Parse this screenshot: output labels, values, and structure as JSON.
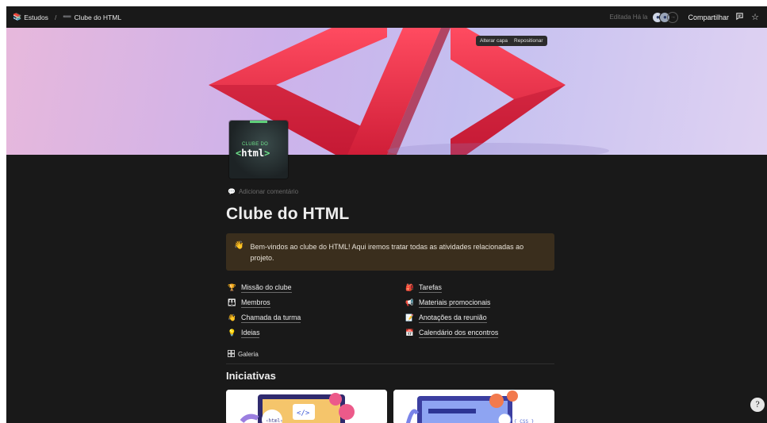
{
  "topbar": {
    "breadcrumb_root": "Estudos",
    "breadcrumb_separator": "/",
    "breadcrumb_page": "Clube do HTML",
    "edited": "Editada Há la",
    "avatars_more": "→",
    "share": "Compartilhar"
  },
  "cover": {
    "change_cover": "Alterar capa",
    "reposition": "Repositionar"
  },
  "page_icon": {
    "small": "CLUBE DO",
    "big_left": "<",
    "big_word": "html",
    "big_right": ">"
  },
  "add_comment": "Adicionar comentário",
  "title": "Clube do HTML",
  "callout": {
    "icon": "hand-wave",
    "text": "Bem-vindos ao clube do HTML! Aqui iremos tratar todas as atividades relacionadas ao projeto."
  },
  "links": [
    {
      "icon": "🏆",
      "label": "Missão do clube"
    },
    {
      "icon": "🎒",
      "label": "Tarefas"
    },
    {
      "icon": "👪",
      "label": "Membros"
    },
    {
      "icon": "📢",
      "label": "Materiais promocionais"
    },
    {
      "icon": "👋",
      "label": "Chamada da turma"
    },
    {
      "icon": "📝",
      "label": "Anotações da reunião"
    },
    {
      "icon": "💡",
      "label": "Ideias"
    },
    {
      "icon": "📅",
      "label": "Calendário dos encontros"
    }
  ],
  "gallery_tab": "Galeria",
  "section_title": "Iniciativas",
  "colors": {
    "background": "#191919",
    "callout": "#3a2e1d",
    "cover_symbol": "#e8304a"
  }
}
